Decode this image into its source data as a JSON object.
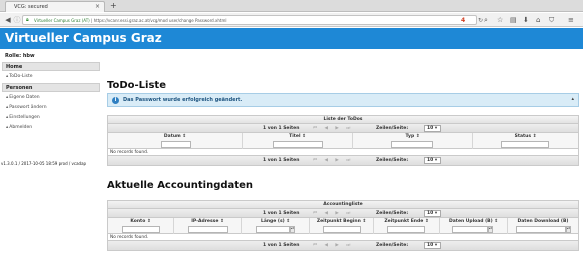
{
  "browser": {
    "tab_title": "VCG: secured",
    "tab_close": "×",
    "new_tab": "+",
    "url_site": "Virtueller Campus Graz (AT)",
    "url_path": "https://vcanr.essi.graz.ac.at/vcg/mod user/change Password.xhtml",
    "badge": "4"
  },
  "header": {
    "title": "Virtueller Campus Graz"
  },
  "sidebar": {
    "role": "Rolle: hbw",
    "home_heading": "Home",
    "home_items": [
      {
        "label": "ToDo-Liste"
      }
    ],
    "persons_heading": "Personen",
    "persons_items": [
      {
        "label": "Eigene Daten"
      },
      {
        "label": "Passwort ändern"
      },
      {
        "label": "Einstellungen"
      },
      {
        "label": "Abmelden"
      }
    ],
    "version": "v1.3.0.1 / 2017-10-05 18:59 prod / vcadap"
  },
  "todo": {
    "title": "ToDo-Liste",
    "message": "Das Passwort wurde erfolgreich geändert.",
    "caption": "Liste der ToDos",
    "pager": {
      "info": "1 von 1 Seiten",
      "rpp_label": "Zeilen/Seite:",
      "rpp_value": "10"
    },
    "columns": [
      "Datum ⇕",
      "Titel ⇕",
      "Typ ⇕",
      "Status ⇕"
    ],
    "empty": "No records found."
  },
  "accounting": {
    "title": "Aktuelle Accountingdaten",
    "caption": "Accountingliste",
    "pager": {
      "info": "1 von 1 Seiten",
      "rpp_label": "Zeilen/Seite:",
      "rpp_value": "10"
    },
    "columns": [
      "Konto ⇕",
      "IP-Adresse ⇕",
      "Länge (s) ⇕",
      "Zeitpunkt Beginn ⇕",
      "Zeitpunkt Ende ⇕",
      "Daten Upload (B) ⇕",
      "Daten Download (B)"
    ],
    "empty": "No records found."
  },
  "colors": {
    "header": "#1e88d6",
    "message_bg": "#d9ecf7"
  }
}
